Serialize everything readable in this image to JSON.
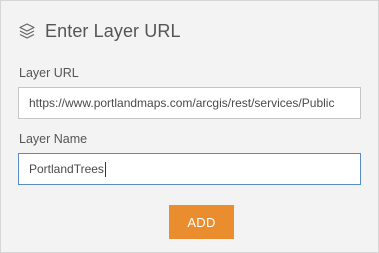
{
  "dialog": {
    "title": "Enter Layer URL",
    "title_icon": "layers-icon"
  },
  "layer_url": {
    "label": "Layer URL",
    "value": "https://www.portlandmaps.com/arcgis/rest/services/Public"
  },
  "layer_name": {
    "label": "Layer Name",
    "value": "PortlandTrees"
  },
  "actions": {
    "add_label": "ADD"
  },
  "colors": {
    "panel_background": "#f3f3f3",
    "accent_orange": "#e98d2e",
    "focus_border": "#5a8cc4"
  }
}
